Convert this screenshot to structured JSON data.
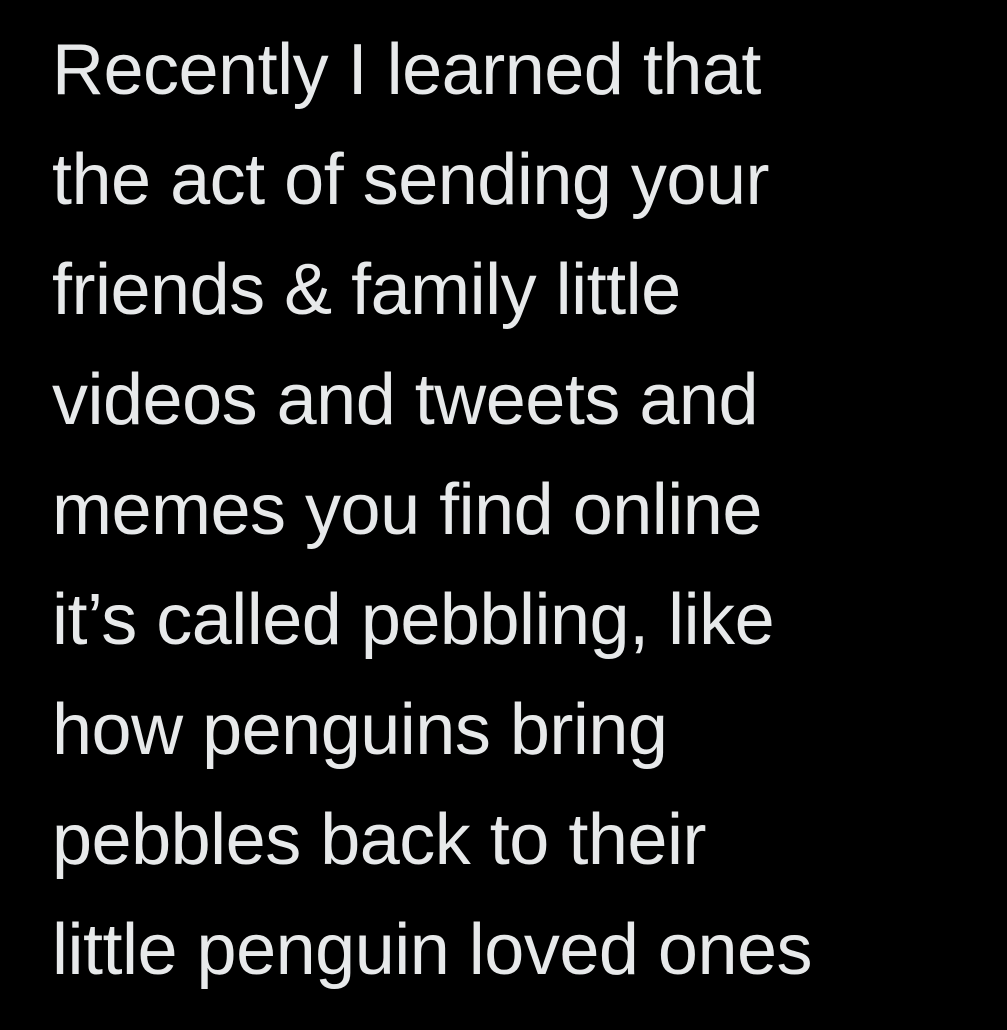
{
  "tweet": {
    "lines": [
      "Recently I learned that",
      "the act of sending your",
      "friends & family little",
      "videos and tweets and",
      "memes you find online",
      "it’s called pebbling, like",
      "how penguins bring",
      "pebbles back to their",
      "little penguin loved ones"
    ]
  },
  "colors": {
    "background": "#000000",
    "text": "#e7e9ea"
  }
}
